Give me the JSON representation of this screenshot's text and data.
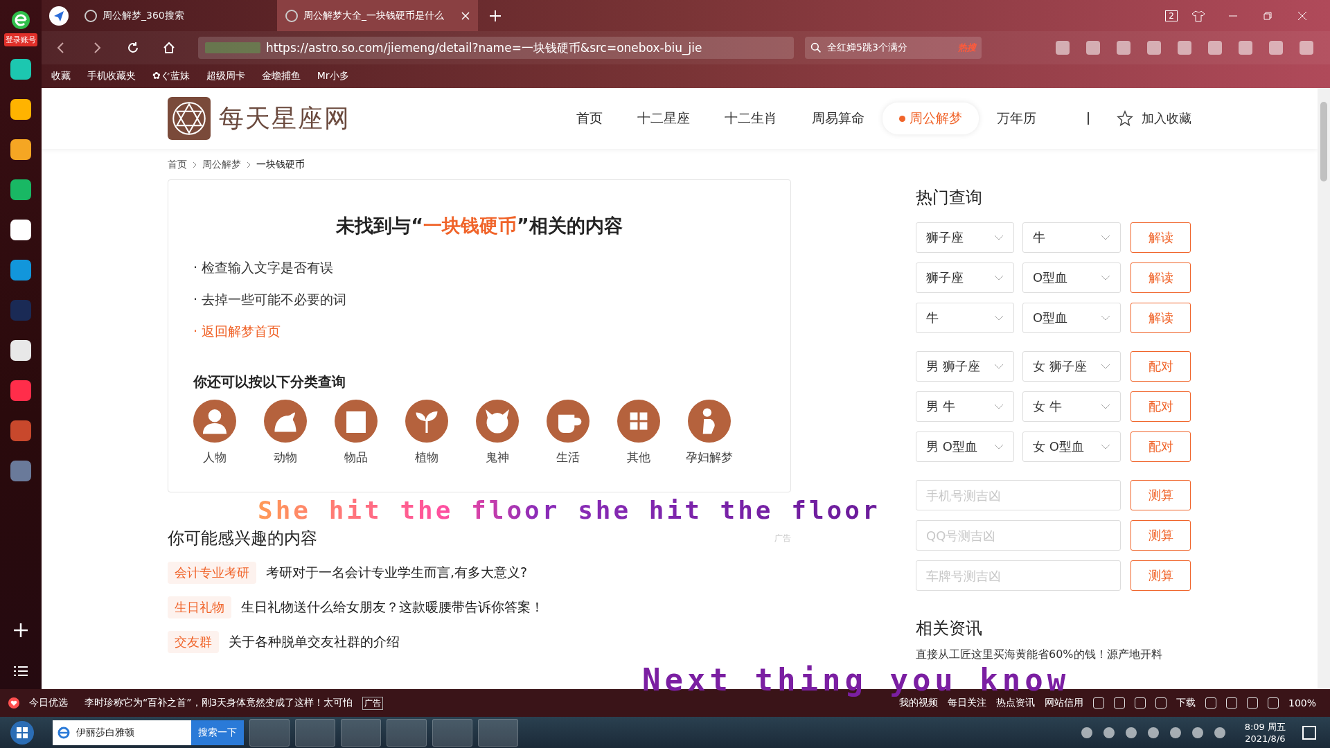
{
  "browser": {
    "tabs": [
      {
        "title": "周公解梦_360搜索",
        "selected": false
      },
      {
        "title": "周公解梦大全_一块钱硬币是什么",
        "selected": true
      }
    ],
    "window_count": "2",
    "url": "https://astro.so.com/jiemeng/detail?name=一块钱硬币&src=onebox-biu_jie",
    "search_value": "全红婵5跳3个满分",
    "hot_badge": "热搜",
    "bookmarks": [
      "收藏",
      "手机收藏夹",
      "✿ぐ蓝妹",
      "超级周卡",
      "金蟾捕鱼",
      "Mr小多"
    ]
  },
  "sidebar": {
    "login": "登录账号"
  },
  "page": {
    "site_name": "每天星座网",
    "nav": [
      {
        "label": "首页",
        "selected": false
      },
      {
        "label": "十二星座",
        "selected": false
      },
      {
        "label": "十二生肖",
        "selected": false
      },
      {
        "label": "周易算命",
        "selected": false
      },
      {
        "label": "周公解梦",
        "selected": true
      },
      {
        "label": "万年历",
        "selected": false
      }
    ],
    "favorite": "加入收藏",
    "breadcrumb": [
      "首页",
      "周公解梦",
      "一块钱硬币"
    ],
    "notice": {
      "before": "未找到与“",
      "keyword": "一块钱硬币",
      "after": "”相关的内容"
    },
    "tips": [
      {
        "kind": "tip",
        "text": "· 检查输入文字是否有误"
      },
      {
        "kind": "tip",
        "text": "· 去掉一些可能不必要的词"
      },
      {
        "kind": "link",
        "text": "· 返回解梦首页"
      }
    ],
    "categories_title": "你还可以按以下分类查询",
    "categories": [
      "人物",
      "动物",
      "物品",
      "植物",
      "鬼神",
      "生活",
      "其他",
      "孕妇解梦"
    ],
    "interest": {
      "title": "你可能感兴趣的内容",
      "ad": "广告",
      "items": [
        {
          "tag": "会计专业考研",
          "text": "考研对于一名会计专业学生而言,有多大意义?"
        },
        {
          "tag": "生日礼物",
          "text": "生日礼物送什么给女朋友？这款暖腰带告诉你答案！"
        },
        {
          "tag": "交友群",
          "text": "关于各种脱单交友社群的介绍"
        }
      ]
    },
    "hot_query": {
      "title": "热门查询",
      "rows": [
        {
          "kind": "select_pair",
          "left": "狮子座",
          "right": "牛",
          "button": "解读"
        },
        {
          "kind": "select_pair",
          "left": "狮子座",
          "right": "O型血",
          "button": "解读"
        },
        {
          "kind": "select_pair",
          "left": "牛",
          "right": "O型血",
          "button": "解读"
        },
        {
          "kind": "select_pair",
          "left": "男 狮子座",
          "right": "女 狮子座",
          "button": "配对"
        },
        {
          "kind": "select_pair",
          "left": "男 牛",
          "right": "女 牛",
          "button": "配对"
        },
        {
          "kind": "select_pair",
          "left": "男 O型血",
          "right": "女 O型血",
          "button": "配对"
        },
        {
          "kind": "input",
          "placeholder": "手机号测吉凶",
          "button": "测算"
        },
        {
          "kind": "input",
          "placeholder": "QQ号测吉凶",
          "button": "测算"
        },
        {
          "kind": "input",
          "placeholder": "车牌号测吉凶",
          "button": "测算"
        }
      ]
    },
    "news": {
      "title": "相关资讯",
      "text": "直接从工匠这里买海黄能省60%的钱！源产地开料"
    }
  },
  "lyrics": [
    "She hit the floor she hit the floor",
    "Next thing you know"
  ],
  "status_bar": {
    "left": "今日优选",
    "headline": "李时珍称它为“百补之首”，刚3天身体竟然变成了这样！太可怕",
    "ad": "广告",
    "items": [
      "我的视频",
      "每日关注",
      "热点资讯",
      "网站信用"
    ],
    "download": "下载",
    "zoom": "100%"
  },
  "taskbar": {
    "search_value": "伊丽莎白雅顿",
    "search_button": "搜索一下",
    "time": "8:09 周五",
    "date": "2021/8/6"
  }
}
